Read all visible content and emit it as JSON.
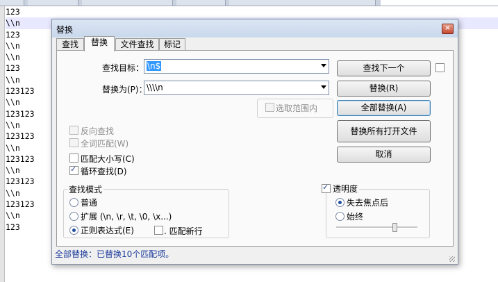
{
  "editor": {
    "lines": [
      "123",
      "\\\\n",
      "123",
      "\\\\n",
      "\\\\n",
      "123",
      "\\\\n",
      "123123",
      "\\\\n",
      "123123",
      "\\\\n",
      "123123",
      "\\\\n",
      "123123",
      "\\\\n",
      "123123",
      "\\\\n",
      "123123",
      "\\\\n",
      "123"
    ]
  },
  "dialog": {
    "title": "替换",
    "tabs": [
      "查找",
      "替换",
      "文件查找",
      "标记"
    ],
    "find_label": "查找目标：",
    "find_value": "\\n$",
    "replace_label": "替换为(P)：",
    "replace_value": "\\\\\\\\n",
    "in_selection": "选取范围内",
    "backward": "反向查找",
    "whole_word": "全词匹配(W)",
    "match_case": "匹配大小写(C)",
    "wrap_around": "循环查找(D)",
    "search_mode": {
      "title": "查找模式",
      "normal": "普通",
      "extended": "扩展 (\\n, \\r, \\t, \\0, \\x...)",
      "regex": "正则表达式(E)",
      "dot_newline": ". 匹配新行"
    },
    "transparency": {
      "title": "透明度",
      "on_lose_focus": "失去焦点后",
      "always": "始终"
    },
    "buttons": {
      "find_next": "查找下一个",
      "replace": "替换(R)",
      "replace_all": "全部替换(A)",
      "replace_all_open": "替换所有打开文件",
      "cancel": "取消"
    },
    "status": "全部替换：已替换10个匹配项。",
    "close_icon": "close-icon"
  }
}
